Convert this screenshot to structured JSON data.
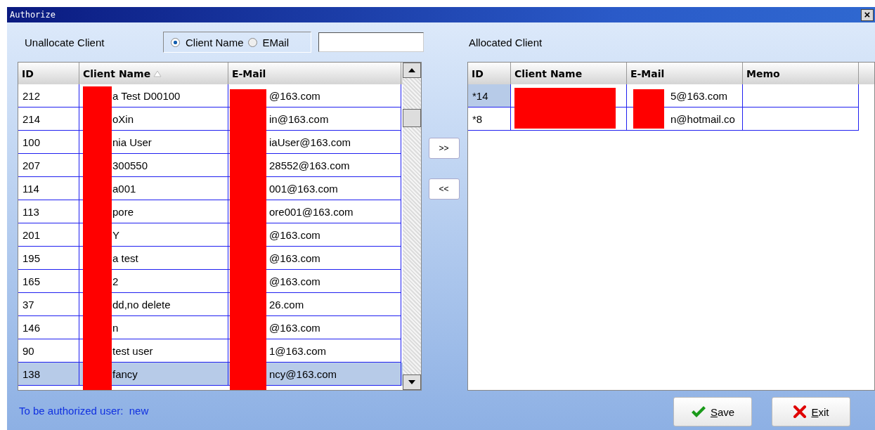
{
  "window": {
    "title": "Authorize",
    "close": "×"
  },
  "left": {
    "label": "Unallocate Client",
    "search_by": [
      {
        "label": "Client Name",
        "selected": true
      },
      {
        "label": "EMail",
        "selected": false
      }
    ],
    "columns": [
      {
        "label": "ID",
        "sorted": false
      },
      {
        "label": "Client Name",
        "sorted": true
      },
      {
        "label": "E-Mail",
        "sorted": false
      }
    ],
    "rows": [
      {
        "id": "212",
        "name": "a Test D00100",
        "email": "@163.com",
        "selected": false
      },
      {
        "id": "214",
        "name": "oXin",
        "email": "in@163.com",
        "selected": false
      },
      {
        "id": "100",
        "name": "nia User",
        "email": "iaUser@163.com",
        "selected": false
      },
      {
        "id": "207",
        "name": "300550",
        "email": "28552@163.com",
        "selected": false
      },
      {
        "id": "114",
        "name": "a001",
        "email": "001@163.com",
        "selected": false
      },
      {
        "id": "113",
        "name": "pore",
        "email": "ore001@163.com",
        "selected": false
      },
      {
        "id": "201",
        "name": "Y",
        "email": "@163.com",
        "selected": false
      },
      {
        "id": "195",
        "name": "a test",
        "email": "@163.com",
        "selected": false
      },
      {
        "id": "165",
        "name": "2",
        "email": "@163.com",
        "selected": false
      },
      {
        "id": "37",
        "name": "dd,no delete",
        "email": "26.com",
        "selected": false
      },
      {
        "id": "146",
        "name": "n",
        "email": "@163.com",
        "selected": false
      },
      {
        "id": "90",
        "name": "test user",
        "email": "1@163.com",
        "selected": false
      },
      {
        "id": "138",
        "name": "fancy",
        "email": "ncy@163.com",
        "selected": true
      }
    ]
  },
  "move_buttons": [
    ">>",
    "<<"
  ],
  "right": {
    "label": "Allocated Client",
    "columns": [
      "ID",
      "Client Name",
      "E-Mail",
      "Memo"
    ],
    "rows": [
      {
        "id": "*14",
        "email": "5@163.com",
        "selected": true
      },
      {
        "id": "*8",
        "email": "n@hotmail.co",
        "selected": false
      }
    ]
  },
  "status": {
    "label": "To be authorized user:",
    "value": "new"
  },
  "buttons": [
    {
      "kind": "save",
      "label": "Save"
    },
    {
      "kind": "exit",
      "label": "Exit"
    }
  ]
}
